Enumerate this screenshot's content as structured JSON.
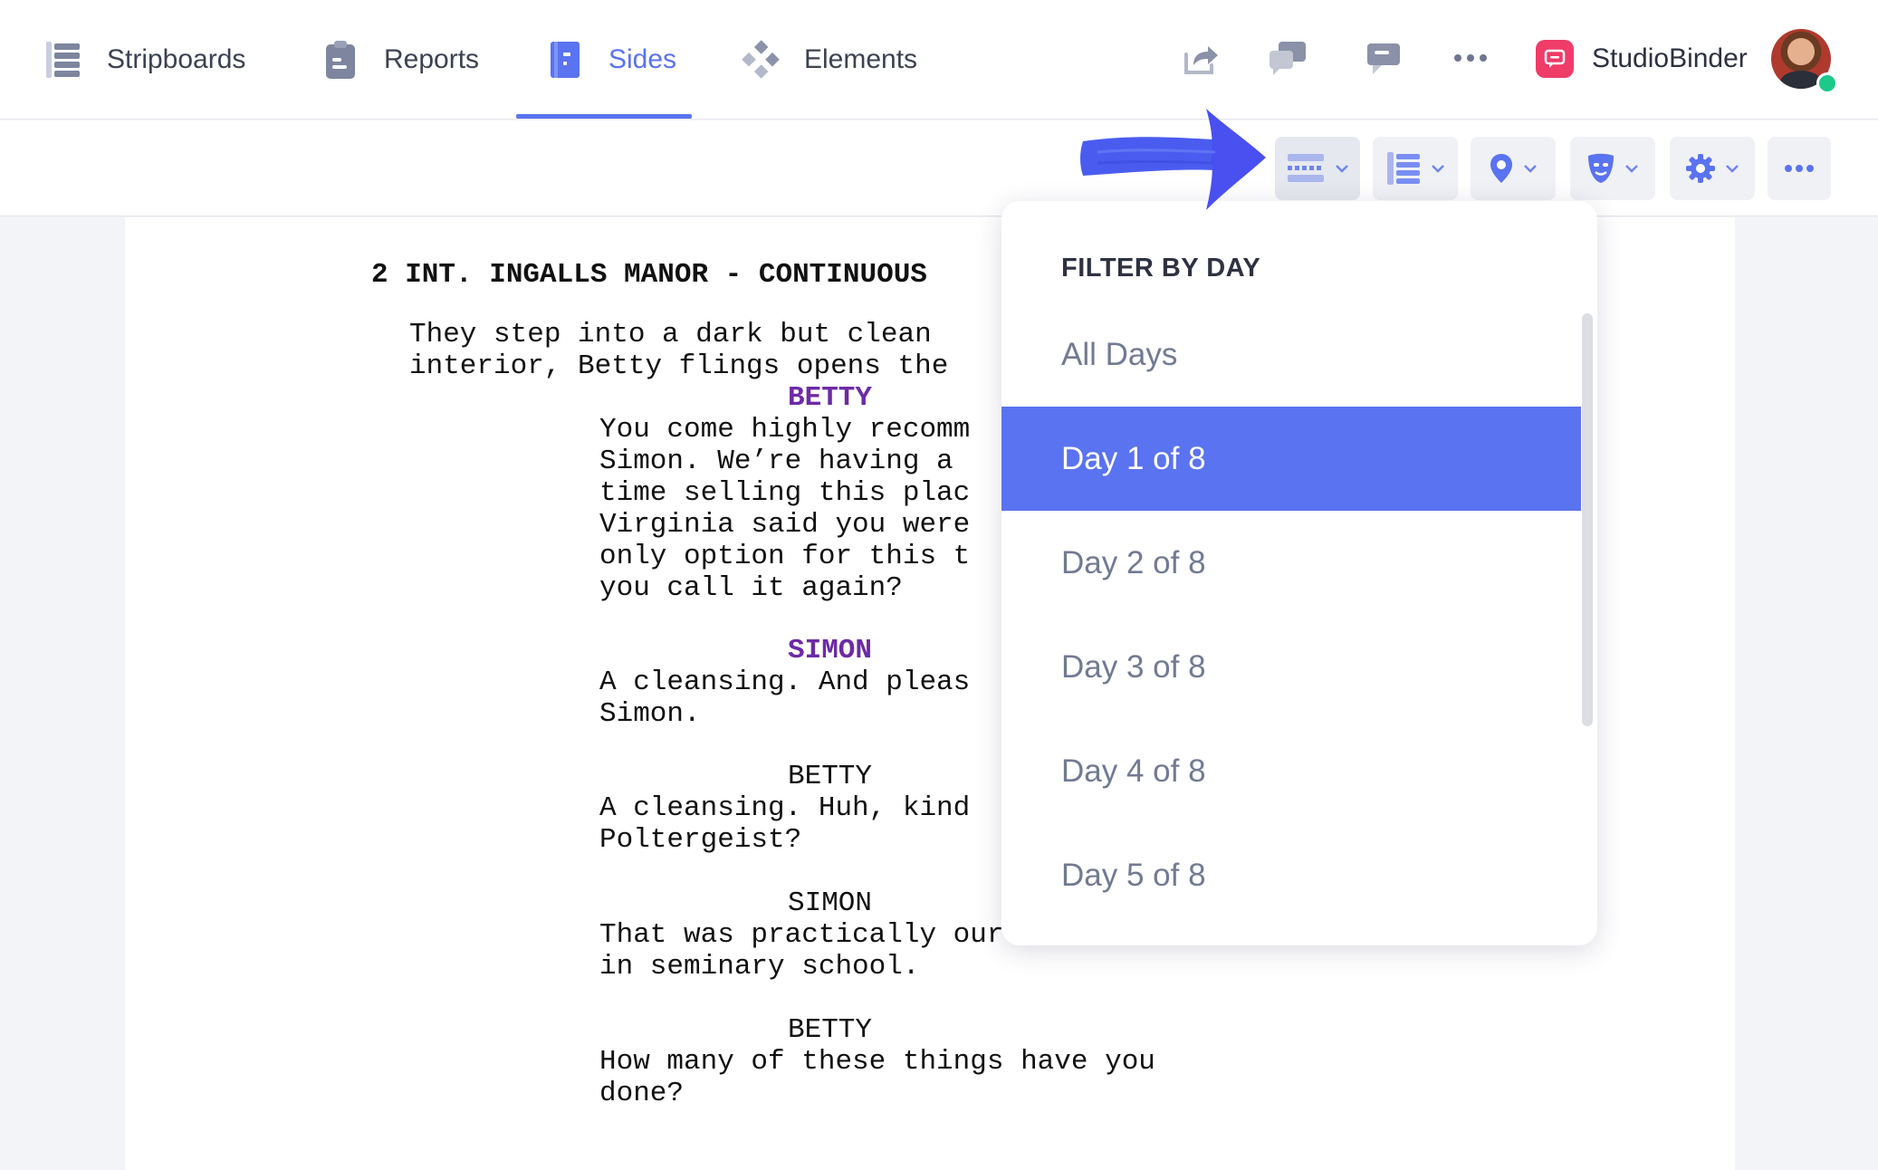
{
  "nav": {
    "items": [
      {
        "label": "Stripboards",
        "icon": "stripboard-icon"
      },
      {
        "label": "Reports",
        "icon": "clipboard-icon"
      },
      {
        "label": "Sides",
        "icon": "sides-document-icon",
        "active": true
      },
      {
        "label": "Elements",
        "icon": "elements-diamond-icon"
      }
    ],
    "actions": [
      "share-icon",
      "chat-icon",
      "comment-icon",
      "more-horizontal-icon"
    ],
    "brand": "StudioBinder"
  },
  "toolbar": {
    "buttons": [
      "filter-by-day-icon",
      "scenes-list-icon",
      "location-pin-icon",
      "character-mask-icon",
      "settings-gear-icon",
      "more-horizontal-icon"
    ]
  },
  "script": {
    "heading": "2 INT. INGALLS MANOR - CONTINUOUS",
    "action": [
      "They step into a dark but clean",
      "interior, Betty flings opens the"
    ],
    "blocks": [
      {
        "character": "BETTY",
        "lines": [
          "You come highly recomm",
          "Simon. We’re having a ",
          "time selling this plac",
          "Virginia said you were",
          "only option for this t",
          "you call it again?"
        ]
      },
      {
        "character": "SIMON",
        "lines": [
          "A cleansing. And pleas",
          "Simon."
        ]
      },
      {
        "character": "BETTY",
        "lines": [
          "A cleansing. Huh, kind",
          "Poltergeist?"
        ]
      },
      {
        "character": "SIMON",
        "lines": [
          "That was practically our textbook",
          "in seminary school."
        ]
      },
      {
        "character": "BETTY",
        "lines": [
          "How many of these things have you",
          "done?"
        ]
      }
    ]
  },
  "dropdown": {
    "title": "FILTER BY DAY",
    "items": [
      "All Days",
      "Day 1 of 8",
      "Day 2 of 8",
      "Day 3 of 8",
      "Day 4 of 8",
      "Day 5 of 8"
    ],
    "selected": "Day 1 of 8"
  },
  "colors": {
    "accent": "#5a73f0",
    "character_highlight": "#6d2aa6",
    "brand": "#ef3c69",
    "arrow": "#4a5cf0"
  }
}
